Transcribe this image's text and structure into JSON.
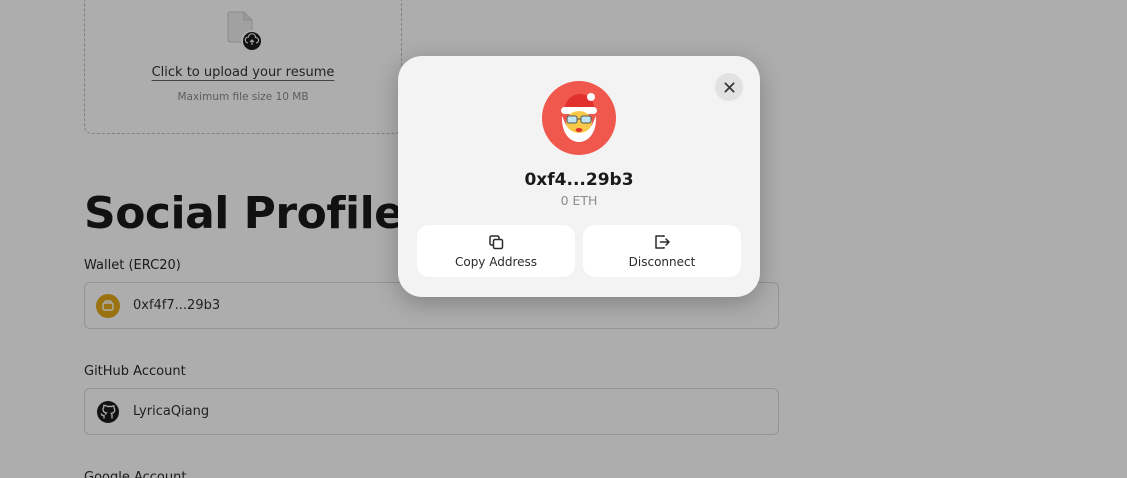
{
  "upload": {
    "link_label": "Click to upload your resume",
    "hint": "Maximum file size 10 MB"
  },
  "social": {
    "title": "Social Profiles",
    "wallet": {
      "label": "Wallet (ERC20)",
      "value": "0xf4f7...29b3"
    },
    "github": {
      "label": "GitHub Account",
      "value": "LyricaQiang"
    },
    "google": {
      "label": "Google Account"
    }
  },
  "modal": {
    "address": "0xf4...29b3",
    "balance": "0 ETH",
    "copy_label": "Copy Address",
    "disconnect_label": "Disconnect",
    "close_icon": "close-icon",
    "avatar_color": "#f0574d"
  },
  "colors": {
    "overlay": "rgba(0,0,0,0.32)",
    "modal_bg": "#f3f3f3",
    "wallet_icon": "#e3a81a"
  }
}
